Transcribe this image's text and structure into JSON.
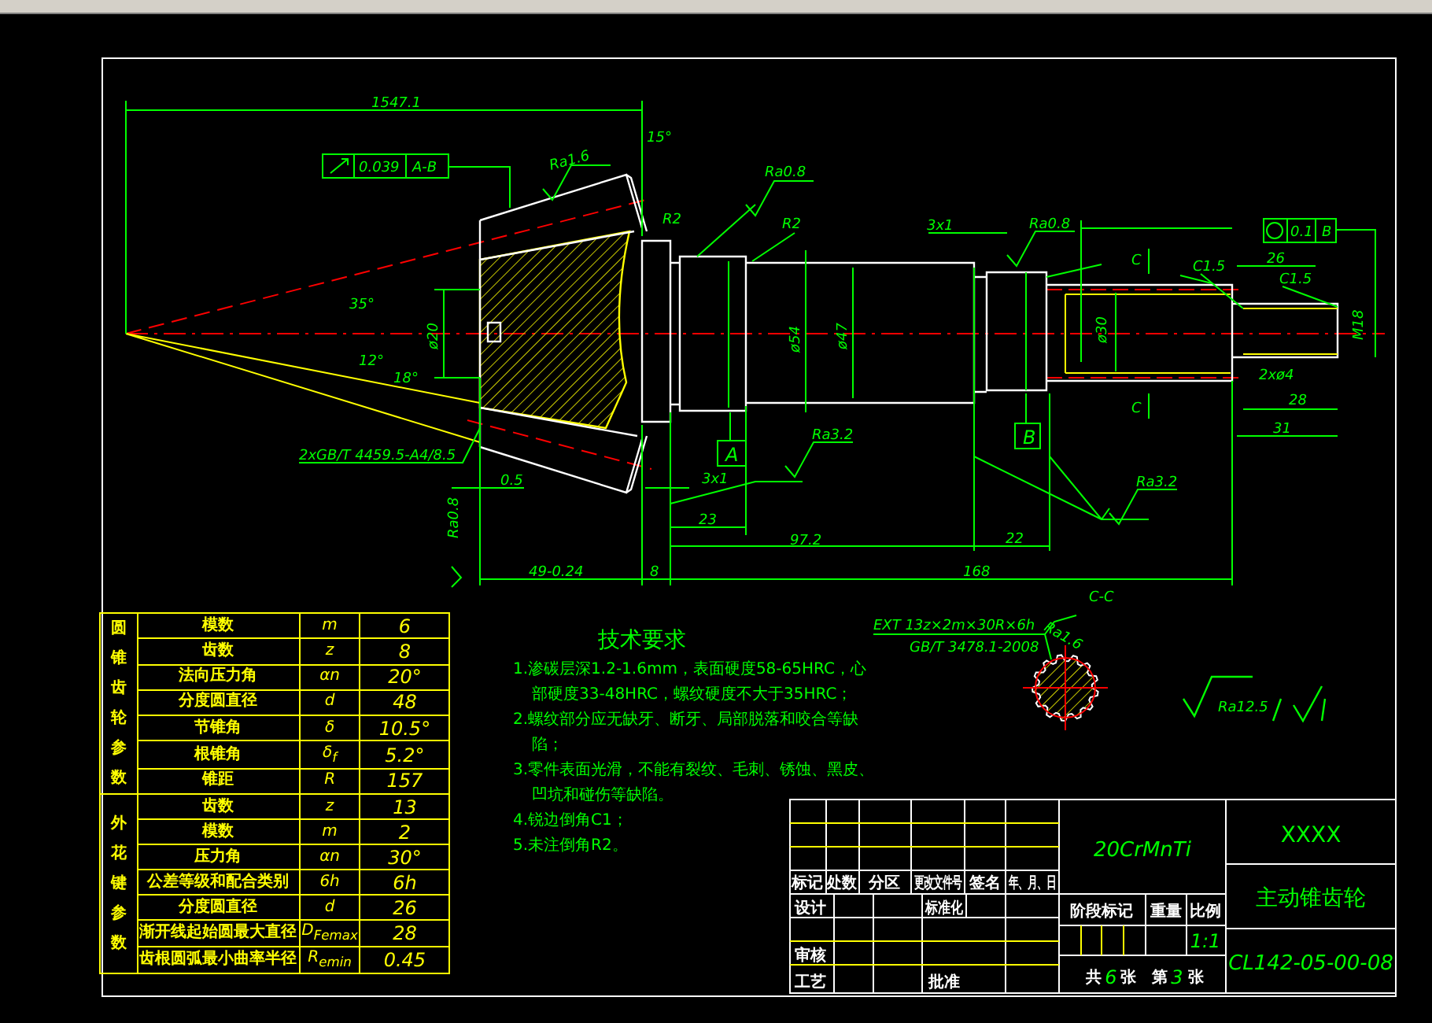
{
  "drawing": {
    "annotations": [
      "1547.1",
      "Ra1.6",
      "15°",
      "R2",
      "35°",
      "12°",
      "18°",
      "ø20",
      "2xGB/T 4459.5-A4/8.5",
      "0.5",
      "Ra0.8",
      "49-0.24",
      "8",
      "Ra0.8",
      "R2",
      "3x1",
      "Ra0.8",
      "26",
      "C1.5",
      "C1.5",
      "ø54",
      "ø47",
      "ø30",
      "M18",
      "C",
      "C",
      "2xø4",
      "28",
      "31",
      "Ra3.2",
      "3x1",
      "23",
      "Ra3.2",
      "97.2",
      "22",
      "168",
      "C-C",
      "Ra1.6"
    ],
    "tolerance_frames": [
      {
        "value": "0.039",
        "datum": "A-B"
      },
      {
        "value": "0.1",
        "datum": "B"
      }
    ],
    "datum_labels": [
      "A",
      "B"
    ],
    "spline_spec": [
      "EXT 13z×2m×30R×6h",
      "GB/T 3478.1-2008"
    ],
    "general_roughness": "Ra12.5"
  },
  "parameter_table": {
    "groups": [
      {
        "label": "圆锥齿轮参数",
        "rows": [
          {
            "name": "模数",
            "symbol": "m",
            "value": "6"
          },
          {
            "name": "齿数",
            "symbol": "z",
            "value": "8"
          },
          {
            "name": "法向压力角",
            "symbol": "αn",
            "value": "20°"
          },
          {
            "name": "分度圆直径",
            "symbol": "d",
            "value": "48"
          },
          {
            "name": "节锥角",
            "symbol": "δ",
            "value": "10.5°"
          },
          {
            "name": "根锥角",
            "symbol": "δ$_{f}$",
            "value": "5.2°"
          },
          {
            "name": "锥距",
            "symbol": "R",
            "value": "157"
          }
        ]
      },
      {
        "label": "外花键参数",
        "rows": [
          {
            "name": "齿数",
            "symbol": "z",
            "value": "13"
          },
          {
            "name": "模数",
            "symbol": "m",
            "value": "2"
          },
          {
            "name": "压力角",
            "symbol": "αn",
            "value": "30°"
          },
          {
            "name": "公差等级和配合类别",
            "symbol": "6h",
            "value": "6h"
          },
          {
            "name": "分度圆直径",
            "symbol": "d",
            "value": "26"
          },
          {
            "name": "渐开线起始圆最大直径",
            "symbol": "D$_{Femax}$",
            "value": "28"
          },
          {
            "name": "齿根圆弧最小曲率半径",
            "symbol": "R$_{emin}$",
            "value": "0.45"
          }
        ]
      }
    ]
  },
  "technical_requirements": {
    "title": "技术要求",
    "items": [
      "1.渗碳层深1.2-1.6mm，表面硬度58-65HRC，心部硬度33-48HRC，螺纹硬度不大于35HRC；",
      "2.螺纹部分应无缺牙、断牙、局部脱落和咬合等缺陷；",
      "3.零件表面光滑，不能有裂纹、毛刺、锈蚀、黑皮、凹坑和碰伤等缺陷。",
      "4.锐边倒角C1；",
      "5.未注倒角R2。"
    ]
  },
  "title_block": {
    "revision_headers": [
      "标记",
      "处数",
      "分区",
      "更改文件号",
      "签名",
      "年、月、日"
    ],
    "signature_labels": [
      "设计",
      "标准化",
      "审核",
      "工艺",
      "批准"
    ],
    "stage_headers": [
      "阶段标记",
      "重量",
      "比例"
    ],
    "scale": "1:1",
    "sheet_count": [
      {
        "label": "共",
        "value": "6",
        "unit": "张"
      },
      {
        "label": "第",
        "value": "3",
        "unit": "张"
      }
    ],
    "material": "20CrMnTi",
    "company": "XXXX",
    "part_name": "主动锥齿轮",
    "drawing_number": "CL142-05-00-08"
  }
}
